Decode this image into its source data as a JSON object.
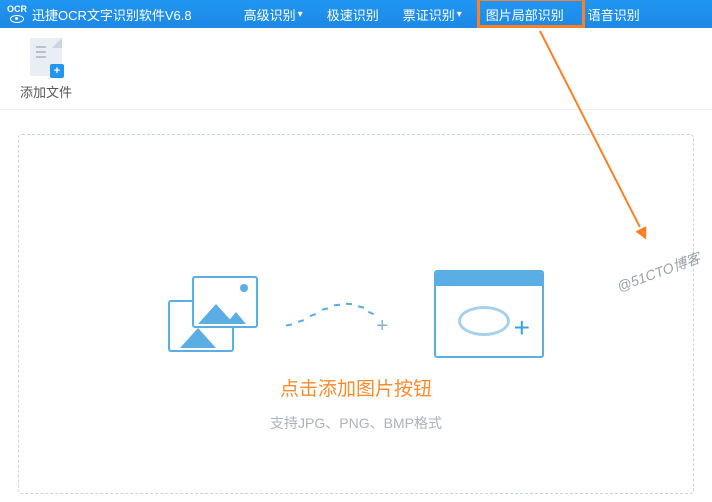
{
  "header": {
    "logo_small": "OCR",
    "title": "迅捷OCR文字识别软件V6.8",
    "nav": [
      "高级识别",
      "极速识别",
      "票证识别",
      "图片局部识别",
      "语音识别"
    ],
    "highlighted_index": 3
  },
  "toolbar": {
    "add_file_label": "添加文件"
  },
  "dropzone": {
    "title": "点击添加图片按钮",
    "subtitle": "支持JPG、PNG、BMP格式"
  },
  "watermark": "@51CTO博客"
}
